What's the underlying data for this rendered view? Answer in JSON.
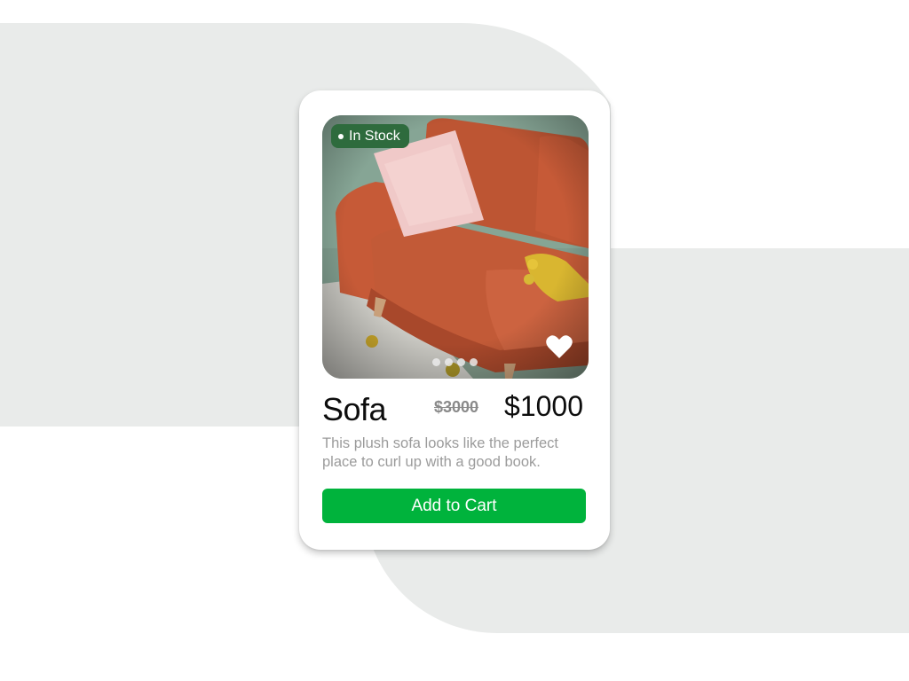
{
  "product": {
    "stock_badge": "In Stock",
    "name": "Sofa",
    "old_price": "$3000",
    "price": "$1000",
    "description": "This plush sofa looks like the perfect place to curl up with a good book.",
    "cart_label": "Add to Cart",
    "favorite_icon": "heart-icon",
    "carousel_count": 4
  },
  "colors": {
    "background_shape": "#e9ebea",
    "badge": "#2e6b3d",
    "cta": "#00b33c",
    "sofa": "#c65a37"
  }
}
